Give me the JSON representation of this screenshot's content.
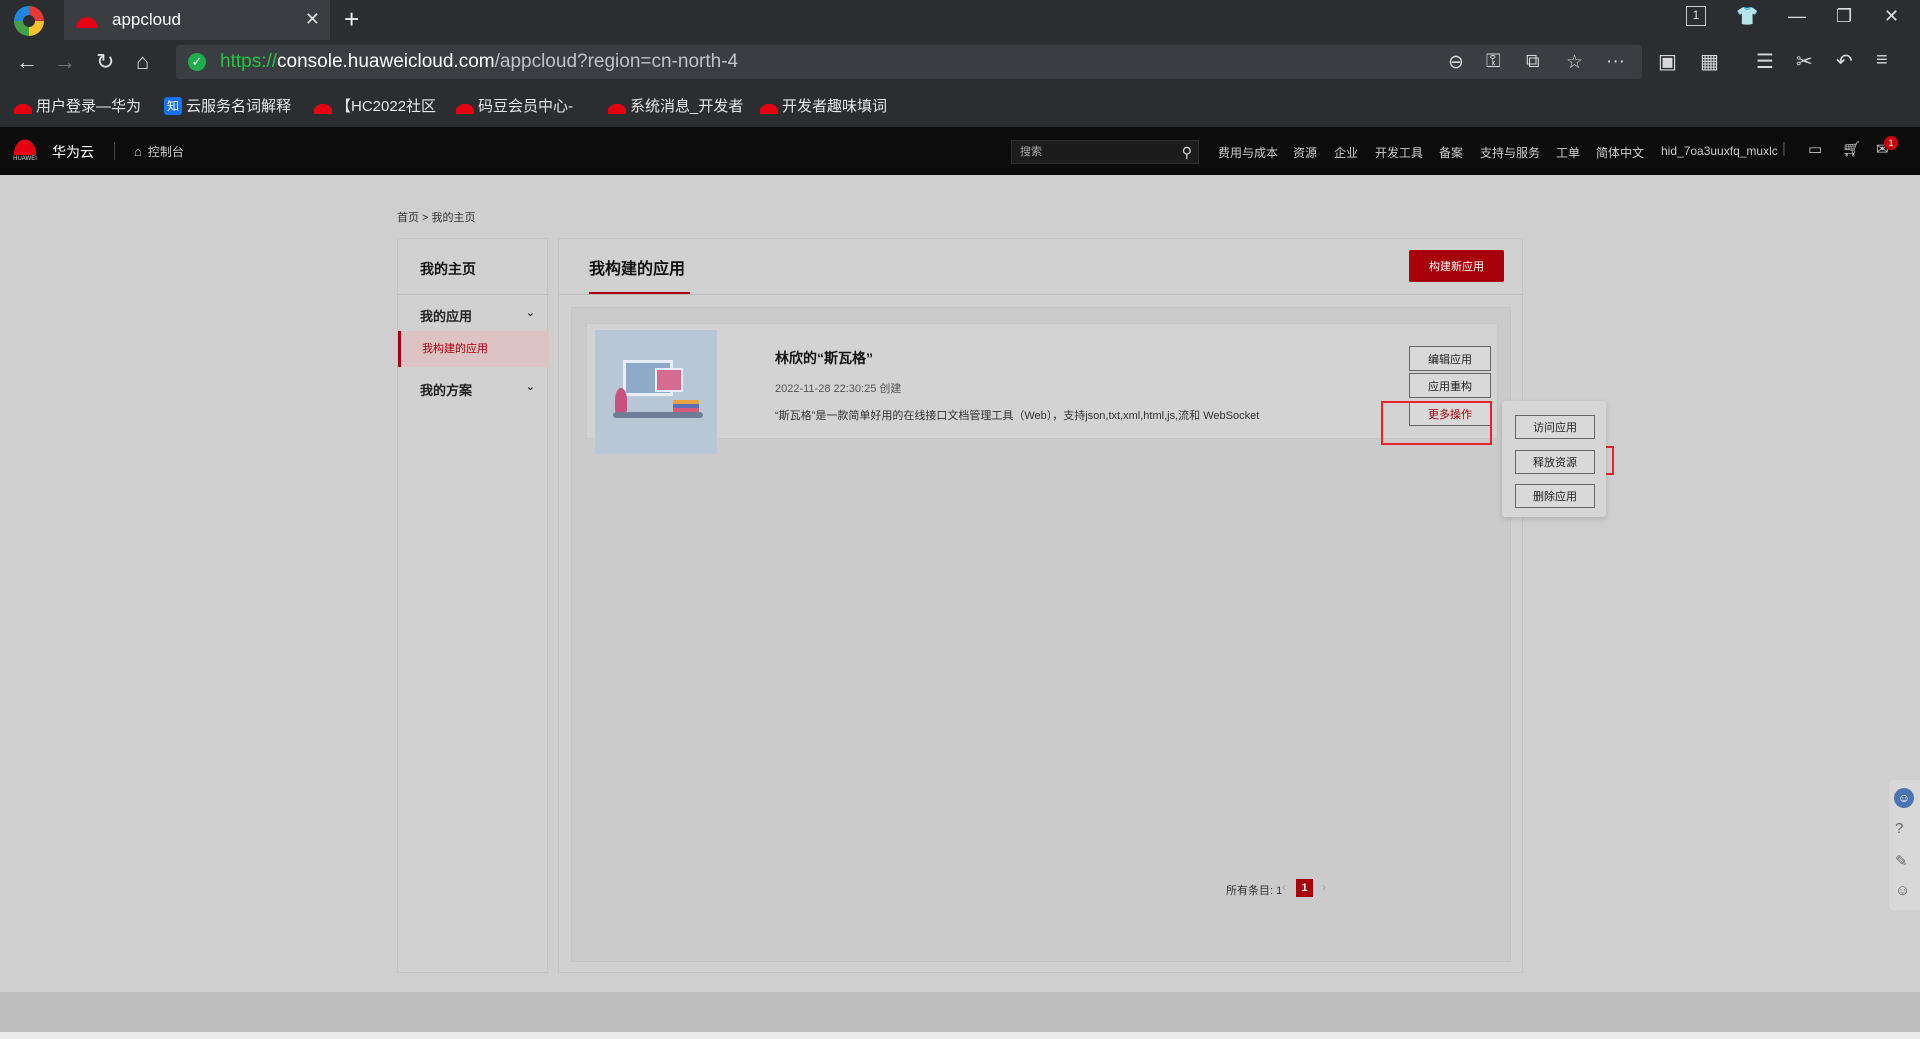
{
  "browser": {
    "tab_title": "appcloud",
    "url_scheme": "https://",
    "url_host": "console.huaweicloud.com",
    "url_path": "/appcloud?region=cn-north-4",
    "tab_counter": "1",
    "bookmarks": [
      {
        "label": "用户登录—华为",
        "icon": "huawei-flower"
      },
      {
        "label": "云服务名词解释",
        "icon": "zhihu-icon"
      },
      {
        "label": "【HC2022社区",
        "icon": "huawei-flower"
      },
      {
        "label": "码豆会员中心-",
        "icon": "huawei-flower"
      },
      {
        "label": "系统消息_开发者",
        "icon": "huawei-flower"
      },
      {
        "label": "开发者趣味填词",
        "icon": "huawei-flower"
      }
    ],
    "zhi_glyph": "知"
  },
  "header": {
    "logo_word": "HUAWEI",
    "brand": "华为云",
    "console_link": "控制台",
    "search_placeholder": "搜索",
    "nav": [
      "费用与成本",
      "资源",
      "企业",
      "开发工具",
      "备案",
      "支持与服务",
      "工单",
      "简体中文"
    ],
    "user": "hid_7oa3uuxfq_muxlc",
    "notification_count": "1"
  },
  "breadcrumb": "首页 > 我的主页",
  "sidebar": {
    "title": "我的主页",
    "groups": [
      "我的应用",
      "我的方案"
    ],
    "active_item": "我构建的应用"
  },
  "main": {
    "tab": "我构建的应用",
    "build_button": "构建新应用",
    "app": {
      "name": "林欣的“斯瓦格”",
      "date": "2022-11-28 22:30:25 创建",
      "description": "“斯瓦格”是一款简单好用的在线接口文档管理工具（Web），支持json,txt,xml,html,js,流和 WebSocket",
      "buttons": [
        "编辑应用",
        "应用重构",
        "更多操作"
      ]
    },
    "dropdown": [
      "访问应用",
      "释放资源",
      "删除应用"
    ],
    "pager": {
      "total_label": "所有条目: 1",
      "current_page": "1"
    }
  },
  "colors": {
    "brand_red": "#a8000b",
    "highlight": "#e8232c",
    "url_green": "#28c247"
  }
}
